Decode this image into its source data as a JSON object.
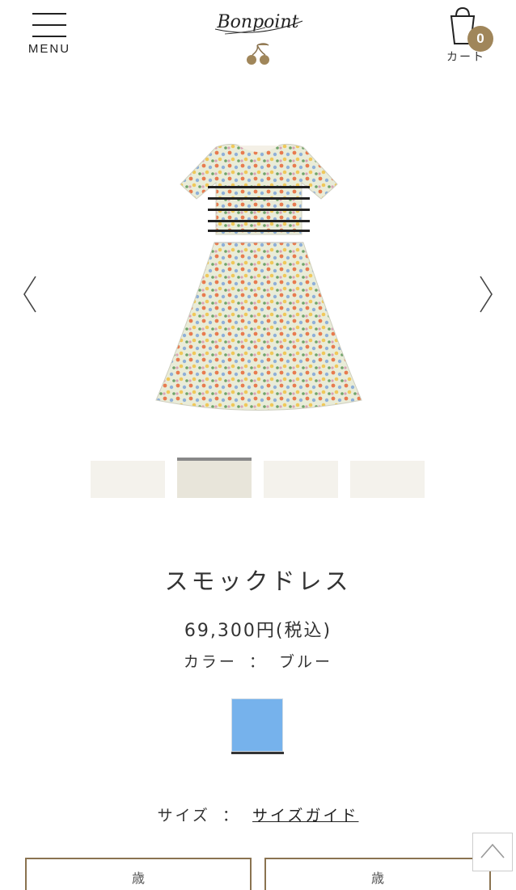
{
  "header": {
    "menu_label": "MENU",
    "logo_text": "Bonpoint",
    "cart_count": "0",
    "cart_label": "カート"
  },
  "product": {
    "name": "スモックドレス",
    "price": "69,300円(税込)",
    "color_label": "カラー",
    "color_separator": "：",
    "color_value": "ブルー",
    "swatch_color": "#76b2ec",
    "size_label": "サイズ",
    "size_separator": "：",
    "size_guide": "サイズガイド"
  },
  "colors": {
    "accent": "#a0865a",
    "button_border": "#8a7350"
  },
  "size_buttons": [
    "歳",
    "歳"
  ]
}
